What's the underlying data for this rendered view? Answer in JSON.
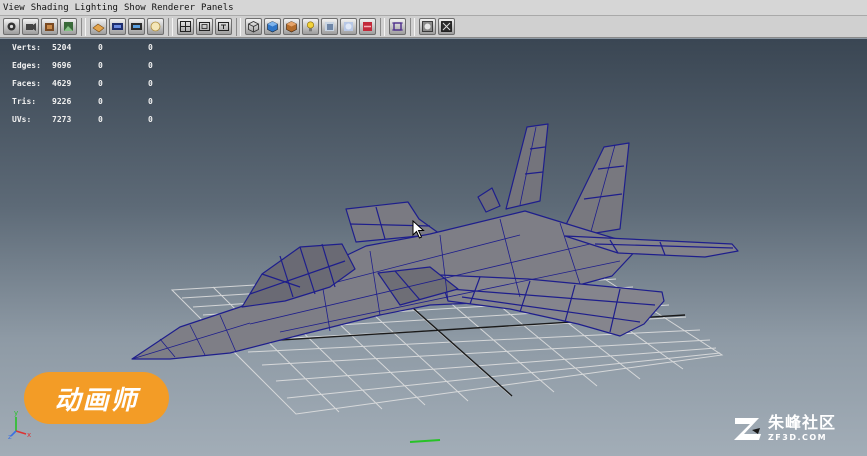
{
  "menu": {
    "items": [
      "View",
      "Shading",
      "Lighting",
      "Show",
      "Renderer",
      "Panels"
    ]
  },
  "toolbar": {
    "icons": [
      "camera-icon",
      "camera-attributes-icon",
      "bookmark-icon",
      "image-plane-icon",
      "grid-icon",
      "film-gate-icon",
      "resolution-gate-icon",
      "gate-mask-icon",
      "field-chart-icon",
      "safe-action-icon",
      "safe-title-icon",
      "wireframe-icon",
      "smooth-shade-icon",
      "textured-icon",
      "use-lights-icon",
      "shadows-icon",
      "screen-ao-icon",
      "motion-blur-icon",
      "isolate-icon",
      "xray-icon",
      "xray-joints-icon"
    ]
  },
  "hud": {
    "rows": [
      {
        "label": "Verts:",
        "value": "5204",
        "sel": "0",
        "comp": "0"
      },
      {
        "label": "Edges:",
        "value": "9696",
        "sel": "0",
        "comp": "0"
      },
      {
        "label": "Faces:",
        "value": "4629",
        "sel": "0",
        "comp": "0"
      },
      {
        "label": "Tris:",
        "value": "9226",
        "sel": "0",
        "comp": "0"
      },
      {
        "label": "UVs:",
        "value": "7273",
        "sel": "0",
        "comp": "0"
      }
    ]
  },
  "overlay": {
    "badge_text": "动画师",
    "watermark_cn": "朱峰社区",
    "watermark_en": "ZF3D.COM"
  },
  "axis": {
    "x": "x",
    "y": "y",
    "z": "z"
  },
  "colors": {
    "wireframe": "#1e1e8c",
    "mesh_fill": "#7e7e86",
    "grid": "#e2e2e2",
    "badge": "#f39c26"
  }
}
